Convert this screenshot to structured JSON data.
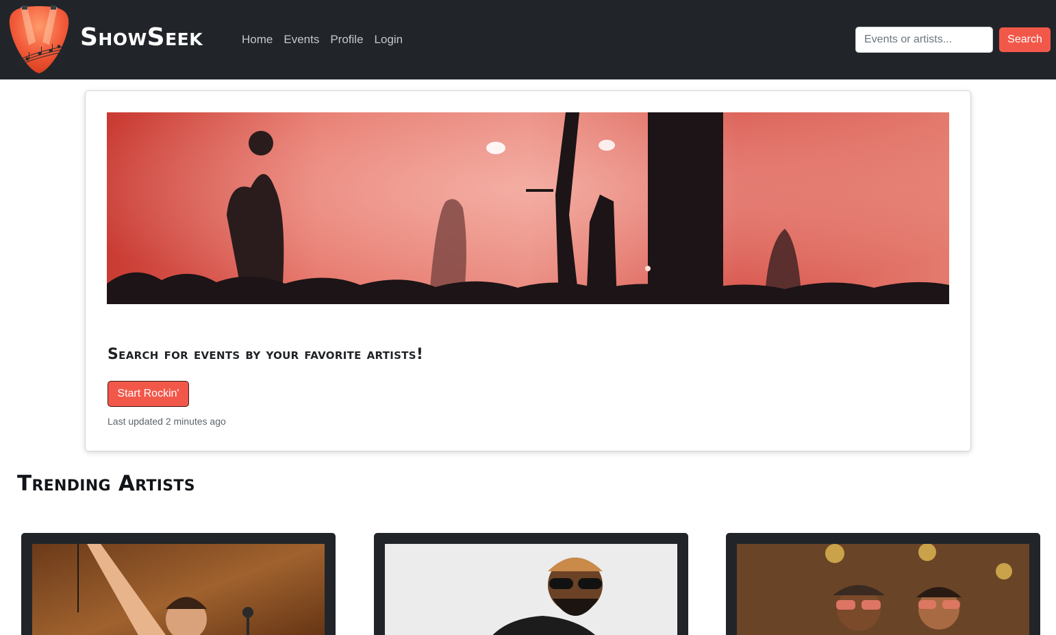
{
  "navbar": {
    "brand": "ShowSeek",
    "links": [
      "Home",
      "Events",
      "Profile",
      "Login"
    ],
    "search_placeholder": "Events or artists...",
    "search_button": "Search",
    "accent_color": "#f2584a",
    "background_color": "#212529"
  },
  "hero": {
    "title": "Search for events by your favorite artists!",
    "button_label": "Start Rockin'",
    "last_updated": "Last updated 2 minutes ago"
  },
  "trending": {
    "title": "Trending Artists"
  },
  "icons": {
    "logo": "guitar-pick-logo-icon"
  }
}
